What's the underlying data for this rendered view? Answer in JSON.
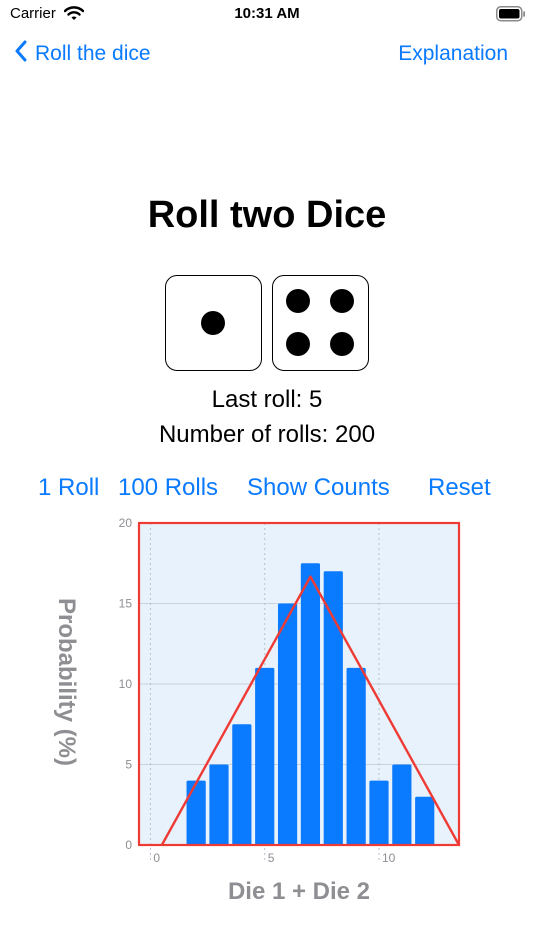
{
  "status_bar": {
    "carrier": "Carrier",
    "time": "10:31 AM"
  },
  "nav": {
    "back_label": "Roll the dice",
    "explanation_label": "Explanation"
  },
  "title": "Roll two Dice",
  "dice": [
    1,
    4
  ],
  "last_roll": "Last roll: 5",
  "roll_count": "Number of rolls: 200",
  "actions": {
    "one_roll": "1 Roll",
    "hundred_rolls": "100 Rolls",
    "show_counts": "Show Counts",
    "reset": "Reset"
  },
  "colors": {
    "accent": "#0a7aff",
    "bar": "#0a7aff",
    "expected_line": "#ef3b36",
    "plot_bg": "#e8f2fc",
    "axis_title": "#8e8e93"
  },
  "chart_data": {
    "type": "bar",
    "xlabel": "Die 1 + Die 2",
    "ylabel": "Probability (%)",
    "x": [
      2,
      3,
      4,
      5,
      6,
      7,
      8,
      9,
      10,
      11,
      12
    ],
    "values": [
      4,
      5,
      7.5,
      11,
      15,
      17.5,
      17,
      11,
      4,
      5,
      3
    ],
    "xlim": [
      -0.5,
      13.5
    ],
    "ylim": [
      0,
      20
    ],
    "xticks": [
      0,
      5,
      10
    ],
    "yticks": [
      0,
      5,
      10,
      15,
      20
    ],
    "grid": true,
    "expected_line": {
      "x": [
        0.5,
        7,
        13.5
      ],
      "y": [
        0,
        16.67,
        0
      ]
    }
  }
}
